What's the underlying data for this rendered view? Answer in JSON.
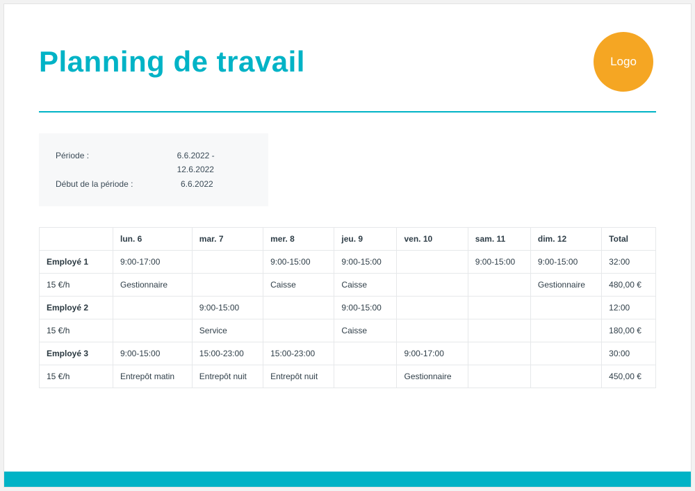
{
  "header": {
    "title": "Planning de travail",
    "logo_text": "Logo"
  },
  "period": {
    "label_periode": "Période :",
    "value_periode": "6.6.2022  -  12.6.2022",
    "label_debut": "Début de la période :",
    "value_debut": "6.6.2022"
  },
  "table": {
    "headers": [
      "",
      "lun. 6",
      "mar. 7",
      "mer. 8",
      "jeu. 9",
      "ven. 10",
      "sam. 11",
      "dim. 12",
      "Total"
    ],
    "employees": [
      {
        "name": "Employé 1",
        "rate": "15 €/h",
        "hours": [
          "9:00-17:00",
          "",
          "9:00-15:00",
          "9:00-15:00",
          "",
          "9:00-15:00",
          "9:00-15:00",
          "32:00"
        ],
        "roles": [
          "Gestionnaire",
          "",
          "Caisse",
          "Caisse",
          "",
          "",
          "Gestionnaire",
          "480,00 €"
        ]
      },
      {
        "name": "Employé 2",
        "rate": "15 €/h",
        "hours": [
          "",
          "9:00-15:00",
          "",
          "9:00-15:00",
          "",
          "",
          "",
          "12:00"
        ],
        "roles": [
          "",
          "Service",
          "",
          "Caisse",
          "",
          "",
          "",
          "180,00 €"
        ]
      },
      {
        "name": "Employé 3",
        "rate": "15 €/h",
        "hours": [
          "9:00-15:00",
          "15:00-23:00",
          "15:00-23:00",
          "",
          "9:00-17:00",
          "",
          "",
          "30:00"
        ],
        "roles": [
          "Entrepôt matin",
          "Entrepôt nuit",
          "Entrepôt nuit",
          "",
          "Gestionnaire",
          "",
          "",
          "450,00 €"
        ]
      }
    ]
  }
}
